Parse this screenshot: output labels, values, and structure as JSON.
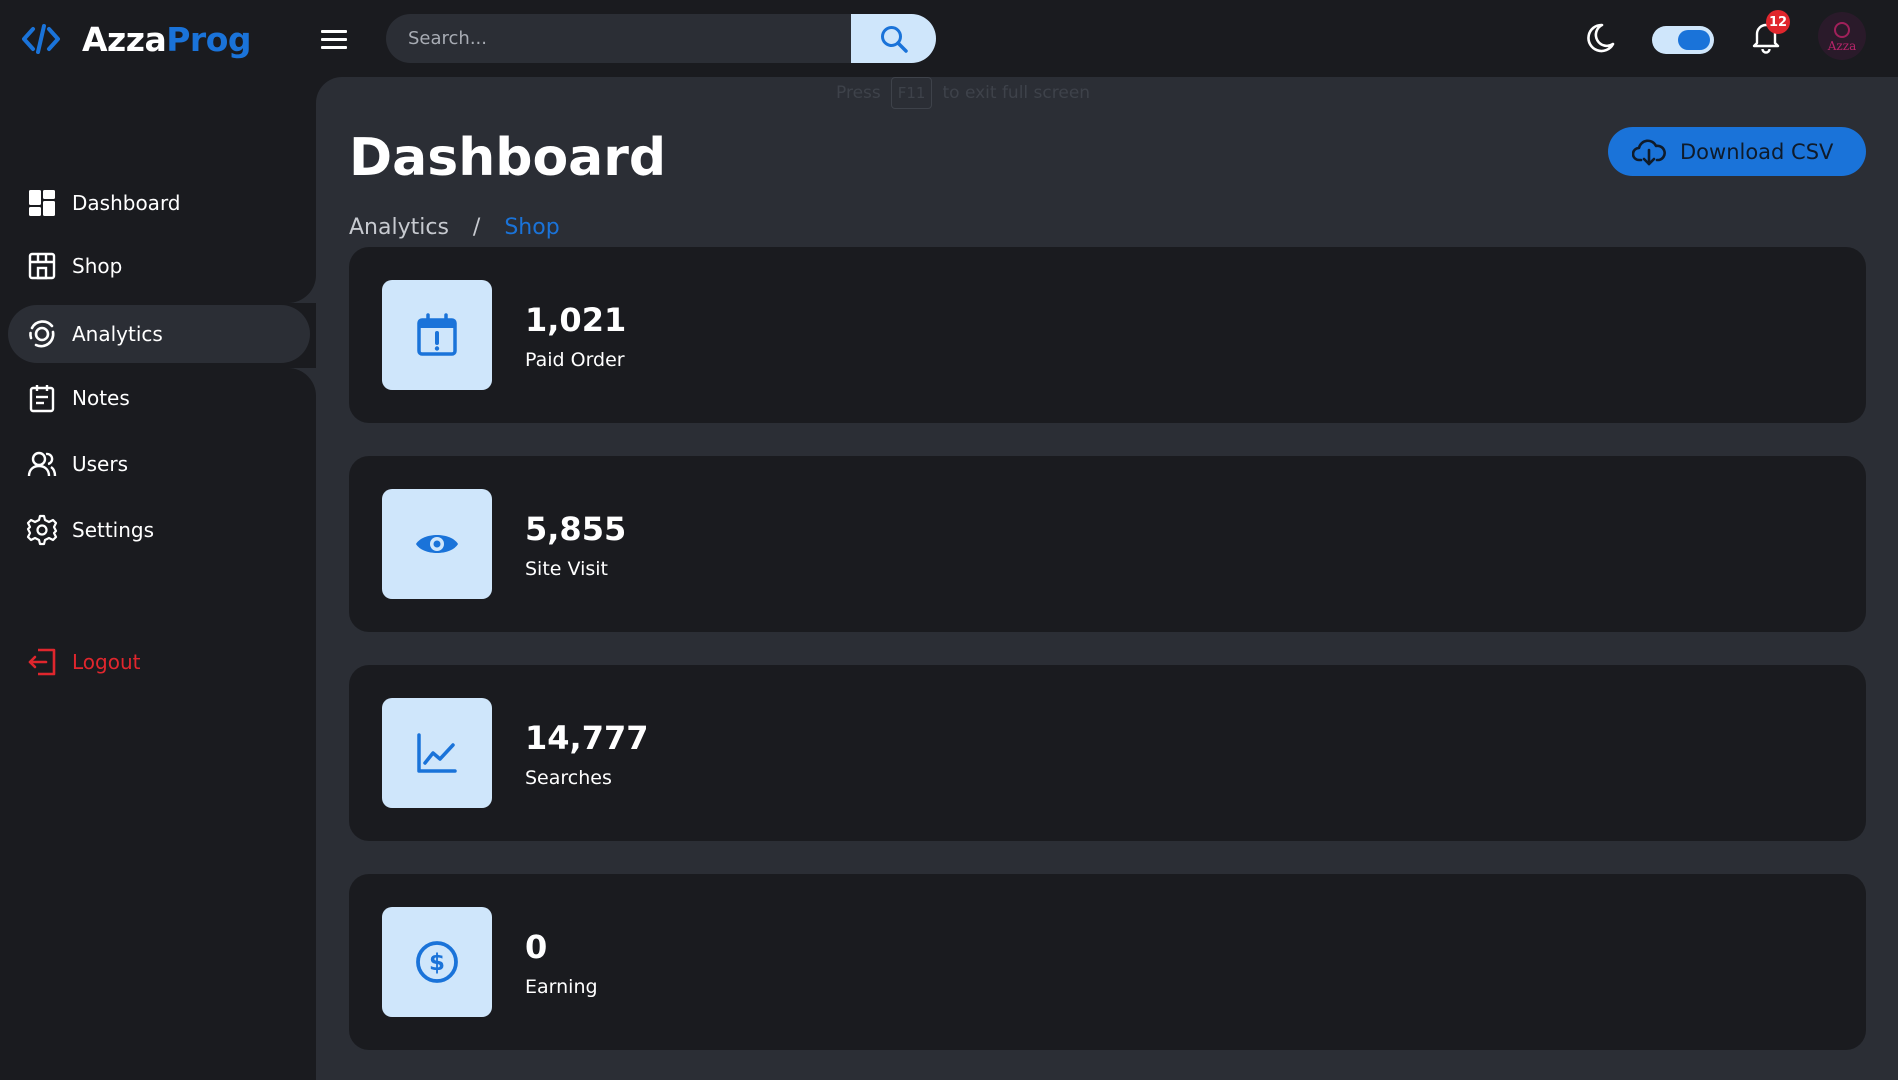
{
  "brand": {
    "part1": "Azza",
    "part2": "Prog"
  },
  "search": {
    "placeholder": "Search..."
  },
  "notifications": {
    "count": "12"
  },
  "avatar": {
    "text": "Azza"
  },
  "sidebar": {
    "items": [
      {
        "label": "Dashboard",
        "icon": "dashboard-icon"
      },
      {
        "label": "Shop",
        "icon": "store-icon"
      },
      {
        "label": "Analytics",
        "icon": "analytics-icon",
        "active": true
      },
      {
        "label": "Notes",
        "icon": "notes-icon"
      },
      {
        "label": "Users",
        "icon": "users-icon"
      },
      {
        "label": "Settings",
        "icon": "gear-icon"
      }
    ],
    "logout": {
      "label": "Logout",
      "icon": "logout-icon"
    }
  },
  "fullscreen_hint": {
    "prefix": "Press",
    "key": "F11",
    "suffix": "to exit full screen"
  },
  "header": {
    "title": "Dashboard",
    "breadcrumb": [
      "Analytics",
      "Shop"
    ],
    "breadcrumb_separator": "/",
    "download_label": "Download CSV"
  },
  "stats": [
    {
      "value": "1,021",
      "label": "Paid Order",
      "icon": "calendar-alert-icon"
    },
    {
      "value": "5,855",
      "label": "Site Visit",
      "icon": "eye-icon"
    },
    {
      "value": "14,777",
      "label": "Searches",
      "icon": "line-chart-icon"
    },
    {
      "value": "0",
      "label": "Earning",
      "icon": "dollar-circle-icon"
    }
  ],
  "colors": {
    "accent": "#1a73d9",
    "background": "#1a1b1f",
    "surface": "#2b2e35",
    "icon_tile": "#cfe6fb",
    "danger": "#e0262d"
  }
}
